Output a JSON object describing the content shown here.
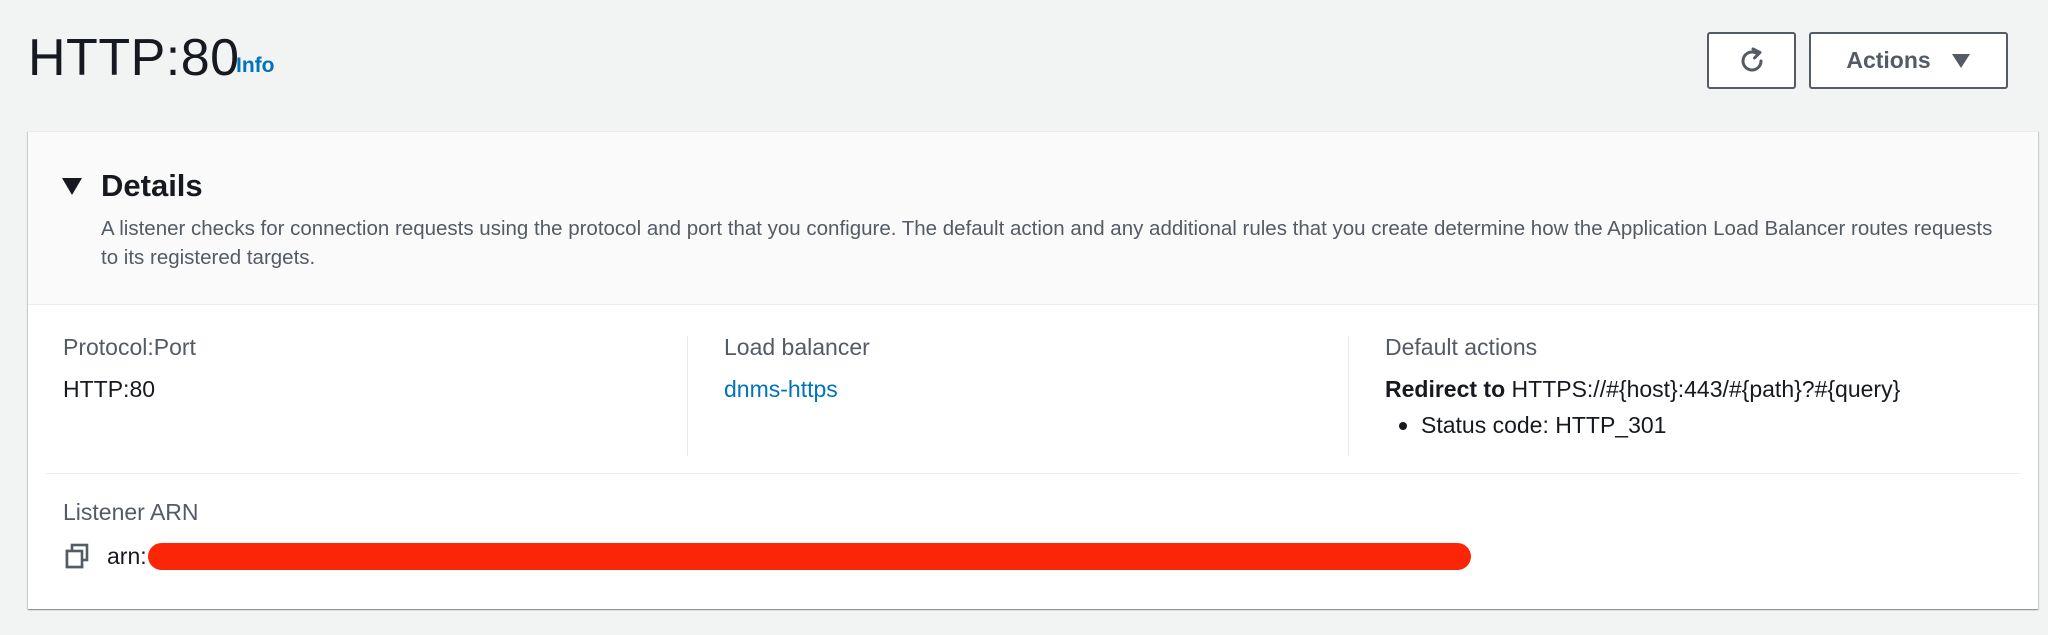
{
  "header": {
    "title": "HTTP:80",
    "info_label": "Info",
    "refresh_icon": "refresh-icon",
    "actions_label": "Actions",
    "actions_icon": "caret-down-icon"
  },
  "details": {
    "title": "Details",
    "caret_icon": "caret-down-icon",
    "description": "A listener checks for connection requests using the protocol and port that you configure. The default action and any additional rules that you create determine how the Application Load Balancer routes requests to its registered targets.",
    "protocol_port": {
      "label": "Protocol:Port",
      "value": "HTTP:80"
    },
    "load_balancer": {
      "label": "Load balancer",
      "value": "dnms-https"
    },
    "default_actions": {
      "label": "Default actions",
      "redirect_label": "Redirect to",
      "redirect_target": "HTTPS://#{host}:443/#{path}?#{query}",
      "status_code": "Status code: HTTP_301"
    },
    "listener_arn": {
      "label": "Listener ARN",
      "copy_icon": "copy-icon",
      "prefix": "arn:",
      "redaction_color": "#fb2508"
    }
  },
  "colors": {
    "link": "#0073bb",
    "background": "#f2f3f3",
    "text": "#16191f",
    "muted": "#545b64"
  }
}
